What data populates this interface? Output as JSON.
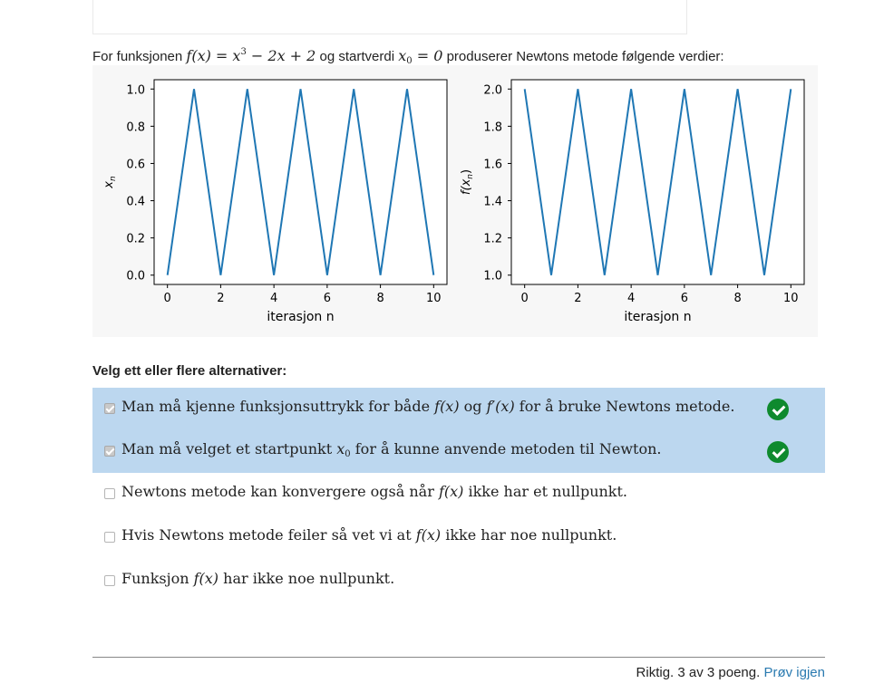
{
  "intro": {
    "prefix": "For funksjonen",
    "function_lhs": "f(x) = x",
    "function_exp": "3",
    "function_rhs": " − 2x + 2",
    "middle": "og startverdi",
    "x_var": "x",
    "x_sub": "0",
    "x_rhs": " = 0",
    "suffix": "produserer Newtons metode følgende verdier:"
  },
  "chart_data": [
    {
      "type": "line",
      "xlabel": "iterasjon n",
      "ylabel_var": "x",
      "ylabel_sub": "n",
      "x": [
        0,
        1,
        2,
        3,
        4,
        5,
        6,
        7,
        8,
        9,
        10
      ],
      "series": [
        {
          "values": [
            0,
            1,
            0,
            1,
            0,
            1,
            0,
            1,
            0,
            1,
            0
          ],
          "color": "#1f77b4"
        }
      ],
      "xlim": [
        -0.5,
        10.5
      ],
      "ylim": [
        -0.05,
        1.05
      ],
      "xticks": [
        0,
        2,
        4,
        6,
        8,
        10
      ],
      "yticks": [
        0.0,
        0.2,
        0.4,
        0.6,
        0.8,
        1.0
      ],
      "ytick_labels": [
        "0.0",
        "0.2",
        "0.4",
        "0.6",
        "0.8",
        "1.0"
      ],
      "grid": false
    },
    {
      "type": "line",
      "xlabel": "iterasjon n",
      "ylabel_var": "f(x",
      "ylabel_sub": "n",
      "ylabel_close": ")",
      "x": [
        0,
        1,
        2,
        3,
        4,
        5,
        6,
        7,
        8,
        9,
        10
      ],
      "series": [
        {
          "values": [
            2,
            1,
            2,
            1,
            2,
            1,
            2,
            1,
            2,
            1,
            2
          ],
          "color": "#1f77b4"
        }
      ],
      "xlim": [
        -0.5,
        10.5
      ],
      "ylim": [
        0.95,
        2.05
      ],
      "xticks": [
        0,
        2,
        4,
        6,
        8,
        10
      ],
      "yticks": [
        1.0,
        1.2,
        1.4,
        1.6,
        1.8,
        2.0
      ],
      "ytick_labels": [
        "1.0",
        "1.2",
        "1.4",
        "1.6",
        "1.8",
        "2.0"
      ],
      "grid": false
    }
  ],
  "question": {
    "prompt": "Velg ett eller flere alternativer:"
  },
  "options": [
    {
      "text_a": "Man må kjenne funksjonsuttrykk for både ",
      "math_a": "f(x)",
      "text_b": " og ",
      "math_b": "f′(x)",
      "text_c": " for å bruke Newtons metode.",
      "checked": true,
      "correct": true
    },
    {
      "text_a": "Man må velget et startpunkt ",
      "math_a": "x",
      "math_a_sub": "0",
      "text_b": " for å kunne anvende metoden til Newton.",
      "checked": true,
      "correct": true
    },
    {
      "text_a": "Newtons metode kan konvergere også når ",
      "math_a": "f(x)",
      "text_b": " ikke har et nullpunkt.",
      "checked": false,
      "correct": false
    },
    {
      "text_a": "Hvis Newtons metode feiler så vet vi at ",
      "math_a": "f(x)",
      "text_b": " ikke har noe nullpunkt.",
      "checked": false,
      "correct": false
    },
    {
      "text_a": "Funksjon ",
      "math_a": "f(x)",
      "text_b": " har ikke noe nullpunkt.",
      "checked": false,
      "correct": false
    }
  ],
  "footer": {
    "score_text": "Riktig. 3 av 3 poeng.",
    "retry_label": "Prøv igjen"
  }
}
